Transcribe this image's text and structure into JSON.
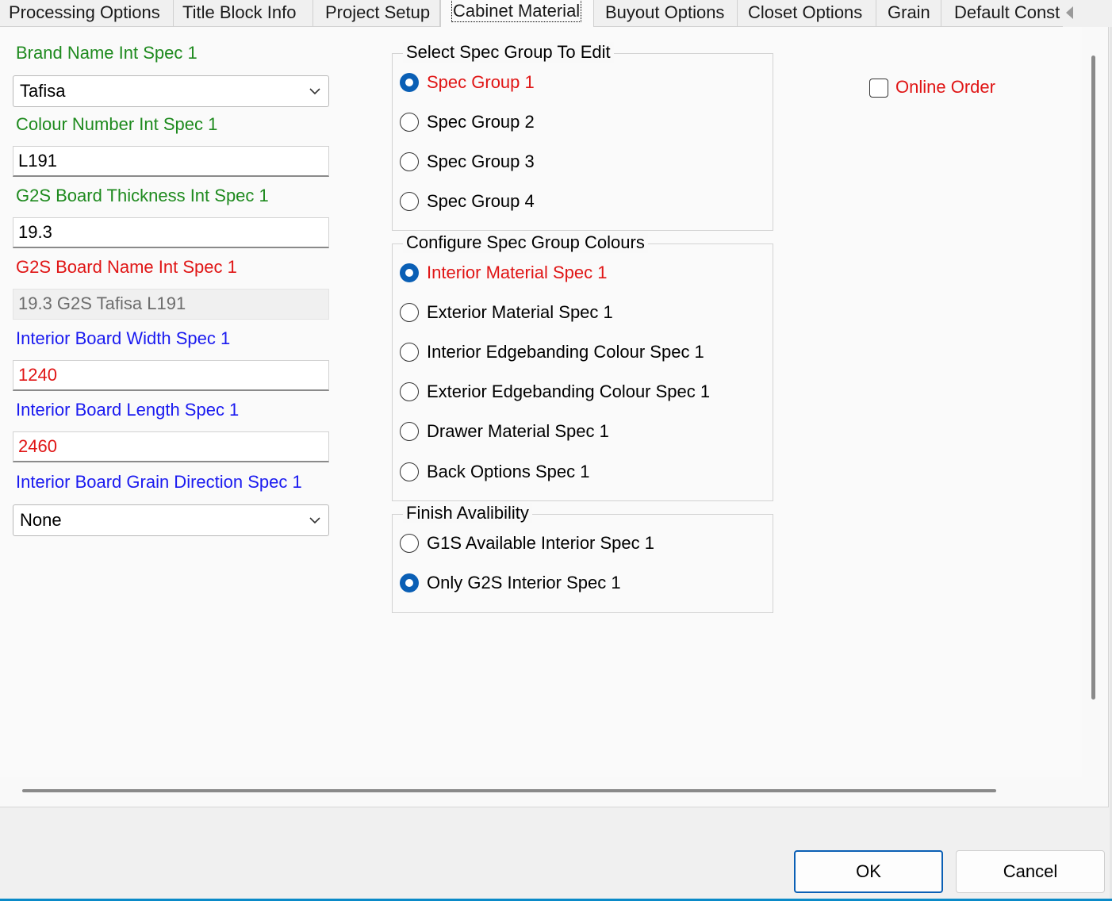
{
  "tabs": [
    {
      "label": "Processing Options"
    },
    {
      "label": "Title Block Info"
    },
    {
      "label": "Project Setup"
    },
    {
      "label": "Cabinet Material",
      "active": true
    },
    {
      "label": "Buyout Options"
    },
    {
      "label": "Closet Options"
    },
    {
      "label": "Grain"
    },
    {
      "label": "Default Const"
    }
  ],
  "fields": {
    "brand_name": {
      "label": "Brand Name Int Spec 1",
      "value": "Tafisa"
    },
    "colour_number": {
      "label": "Colour Number Int Spec 1",
      "value": "L191"
    },
    "board_thickness": {
      "label": "G2S Board Thickness Int Spec 1",
      "value": "19.3"
    },
    "board_name": {
      "label": "G2S Board Name Int Spec 1",
      "value": "19.3 G2S Tafisa L191"
    },
    "board_width": {
      "label": "Interior Board Width Spec 1",
      "value": "1240"
    },
    "board_length": {
      "label": "Interior Board Length Spec 1",
      "value": "2460"
    },
    "grain_direction": {
      "label": "Interior Board Grain Direction Spec 1",
      "value": "None"
    }
  },
  "spec_group": {
    "title": "Select Spec Group To Edit",
    "options": [
      "Spec Group 1",
      "Spec Group 2",
      "Spec Group 3",
      "Spec Group 4"
    ],
    "selected": 0
  },
  "colours": {
    "title": "Configure Spec Group Colours",
    "options": [
      "Interior Material Spec 1",
      "Exterior Material Spec 1",
      "Interior Edgebanding Colour Spec 1",
      "Exterior Edgebanding Colour Spec 1",
      "Drawer Material Spec 1",
      "Back Options Spec 1"
    ],
    "selected": 0
  },
  "finish": {
    "title": "Finish Avalibility",
    "options": [
      "G1S Available Interior Spec 1",
      "Only G2S Interior Spec 1"
    ],
    "selected": 1
  },
  "online_order": {
    "label": "Online Order",
    "checked": false
  },
  "buttons": {
    "ok": "OK",
    "cancel": "Cancel"
  },
  "colors": {
    "accent": "#0a5fb5",
    "label_green": "#1e8a1e",
    "label_red": "#e01515",
    "label_blue": "#1a1af0"
  },
  "icons": {
    "tab_scroll": "chevron-left-icon",
    "dropdown": "chevron-down-icon"
  }
}
